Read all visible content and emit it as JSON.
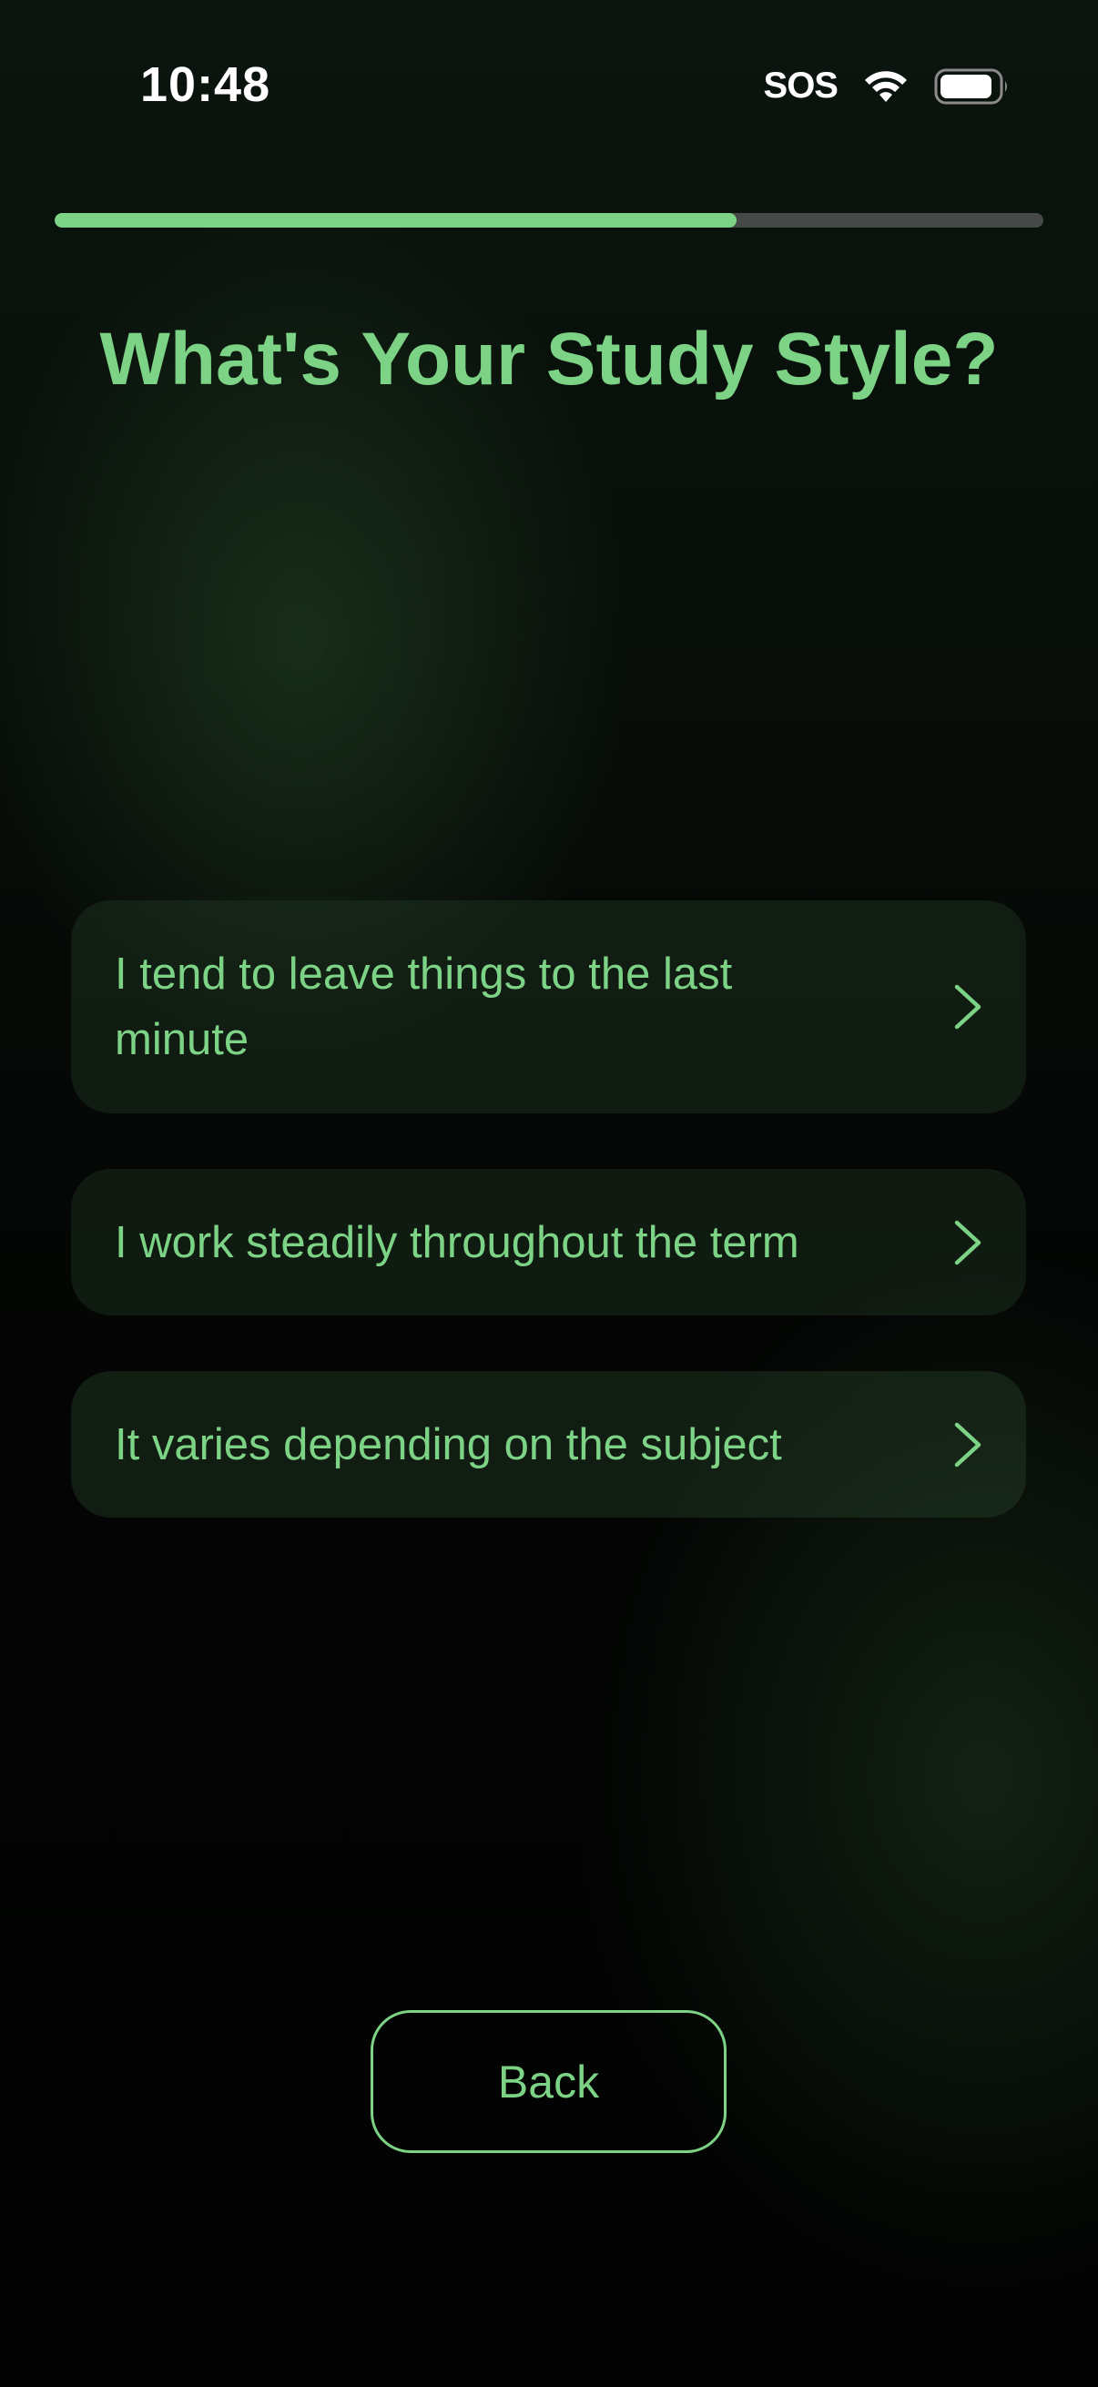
{
  "status_bar": {
    "time": "10:48",
    "sos_label": "SOS",
    "wifi_icon": "wifi-icon",
    "battery_icon": "battery-icon"
  },
  "progress": {
    "fraction": 0.69,
    "fill_color": "#7dd385",
    "track_color": "#474948"
  },
  "question": {
    "title": "What's Your Study Style?"
  },
  "options": [
    {
      "label": "I tend to leave things to the last minute",
      "icon": "chevron-right-icon"
    },
    {
      "label": "I work steadily throughout the term",
      "icon": "chevron-right-icon"
    },
    {
      "label": "It varies depending on the subject",
      "icon": "chevron-right-icon"
    }
  ],
  "footer": {
    "back_label": "Back"
  },
  "colors": {
    "accent": "#7dd385",
    "background": "#020302",
    "option_background": "#1a2a1c"
  }
}
